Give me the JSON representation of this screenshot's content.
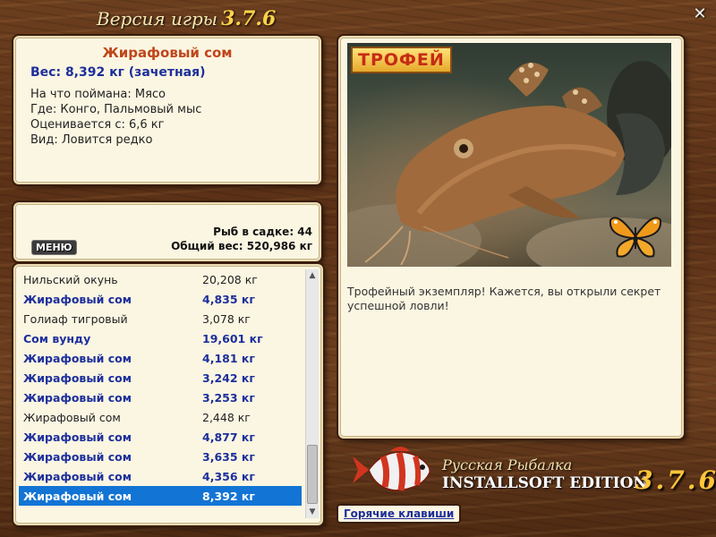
{
  "window": {
    "title_prefix": "Версия игры",
    "title_version": "3.7.6",
    "close_glyph": "✕"
  },
  "catch": {
    "name": "Жирафовый сом",
    "weight": "Вес: 8,392 кг (зачетная)",
    "bait": "На что поймана: Мясо",
    "location": "Где: Конго, Пальмовый мыс",
    "valued_from": "Оценивается с: 6,6 кг",
    "rarity": "Вид: Ловится редко"
  },
  "stats": {
    "menu_label": "МЕНЮ",
    "fish_in_cage": "Рыб в садке: 44",
    "total_weight": "Общий вес: 520,986 кг"
  },
  "list": {
    "rows": [
      {
        "name": "Нильский окунь",
        "weight": "20,208 кг",
        "style": "dim"
      },
      {
        "name": "Жирафовый сом",
        "weight": "4,835 кг",
        "style": "bold"
      },
      {
        "name": "Голиаф тигровый",
        "weight": "3,078 кг",
        "style": "dim"
      },
      {
        "name": "Сом вунду",
        "weight": "19,601 кг",
        "style": "bold"
      },
      {
        "name": "Жирафовый сом",
        "weight": "4,181 кг",
        "style": "bold"
      },
      {
        "name": "Жирафовый сом",
        "weight": "3,242 кг",
        "style": "bold"
      },
      {
        "name": "Жирафовый сом",
        "weight": "3,253 кг",
        "style": "bold"
      },
      {
        "name": "Жирафовый сом",
        "weight": "2,448 кг",
        "style": "dim"
      },
      {
        "name": "Жирафовый сом",
        "weight": "4,877 кг",
        "style": "bold"
      },
      {
        "name": "Жирафовый сом",
        "weight": "3,635 кг",
        "style": "bold"
      },
      {
        "name": "Жирафовый сом",
        "weight": "4,356 кг",
        "style": "bold"
      },
      {
        "name": "Жирафовый сом",
        "weight": "8,392 кг",
        "style": "sel"
      }
    ]
  },
  "photo": {
    "badge": "ТРОФЕЙ",
    "description": "Трофейный экземпляр! Кажется, вы открыли секрет успешной ловли!"
  },
  "branding": {
    "line1": "Русская Рыбалка",
    "line2": "INSTALLSOFT EDITION",
    "version": "3.7.6"
  },
  "hotkeys_label": "Горячие клавиши",
  "icons": {
    "close": "close-icon",
    "scroll_up": "chevron-up-icon",
    "scroll_down": "chevron-down-icon",
    "butterfly": "butterfly-icon",
    "brand_fish": "fish-logo-icon"
  },
  "colors": {
    "wood": "#5a3016",
    "panel": "#fbf6e2",
    "accent_name": "#c0461b",
    "accent_blue": "#1d2f9c",
    "selection": "#1274d4",
    "version_gold": "#ffc53a"
  }
}
